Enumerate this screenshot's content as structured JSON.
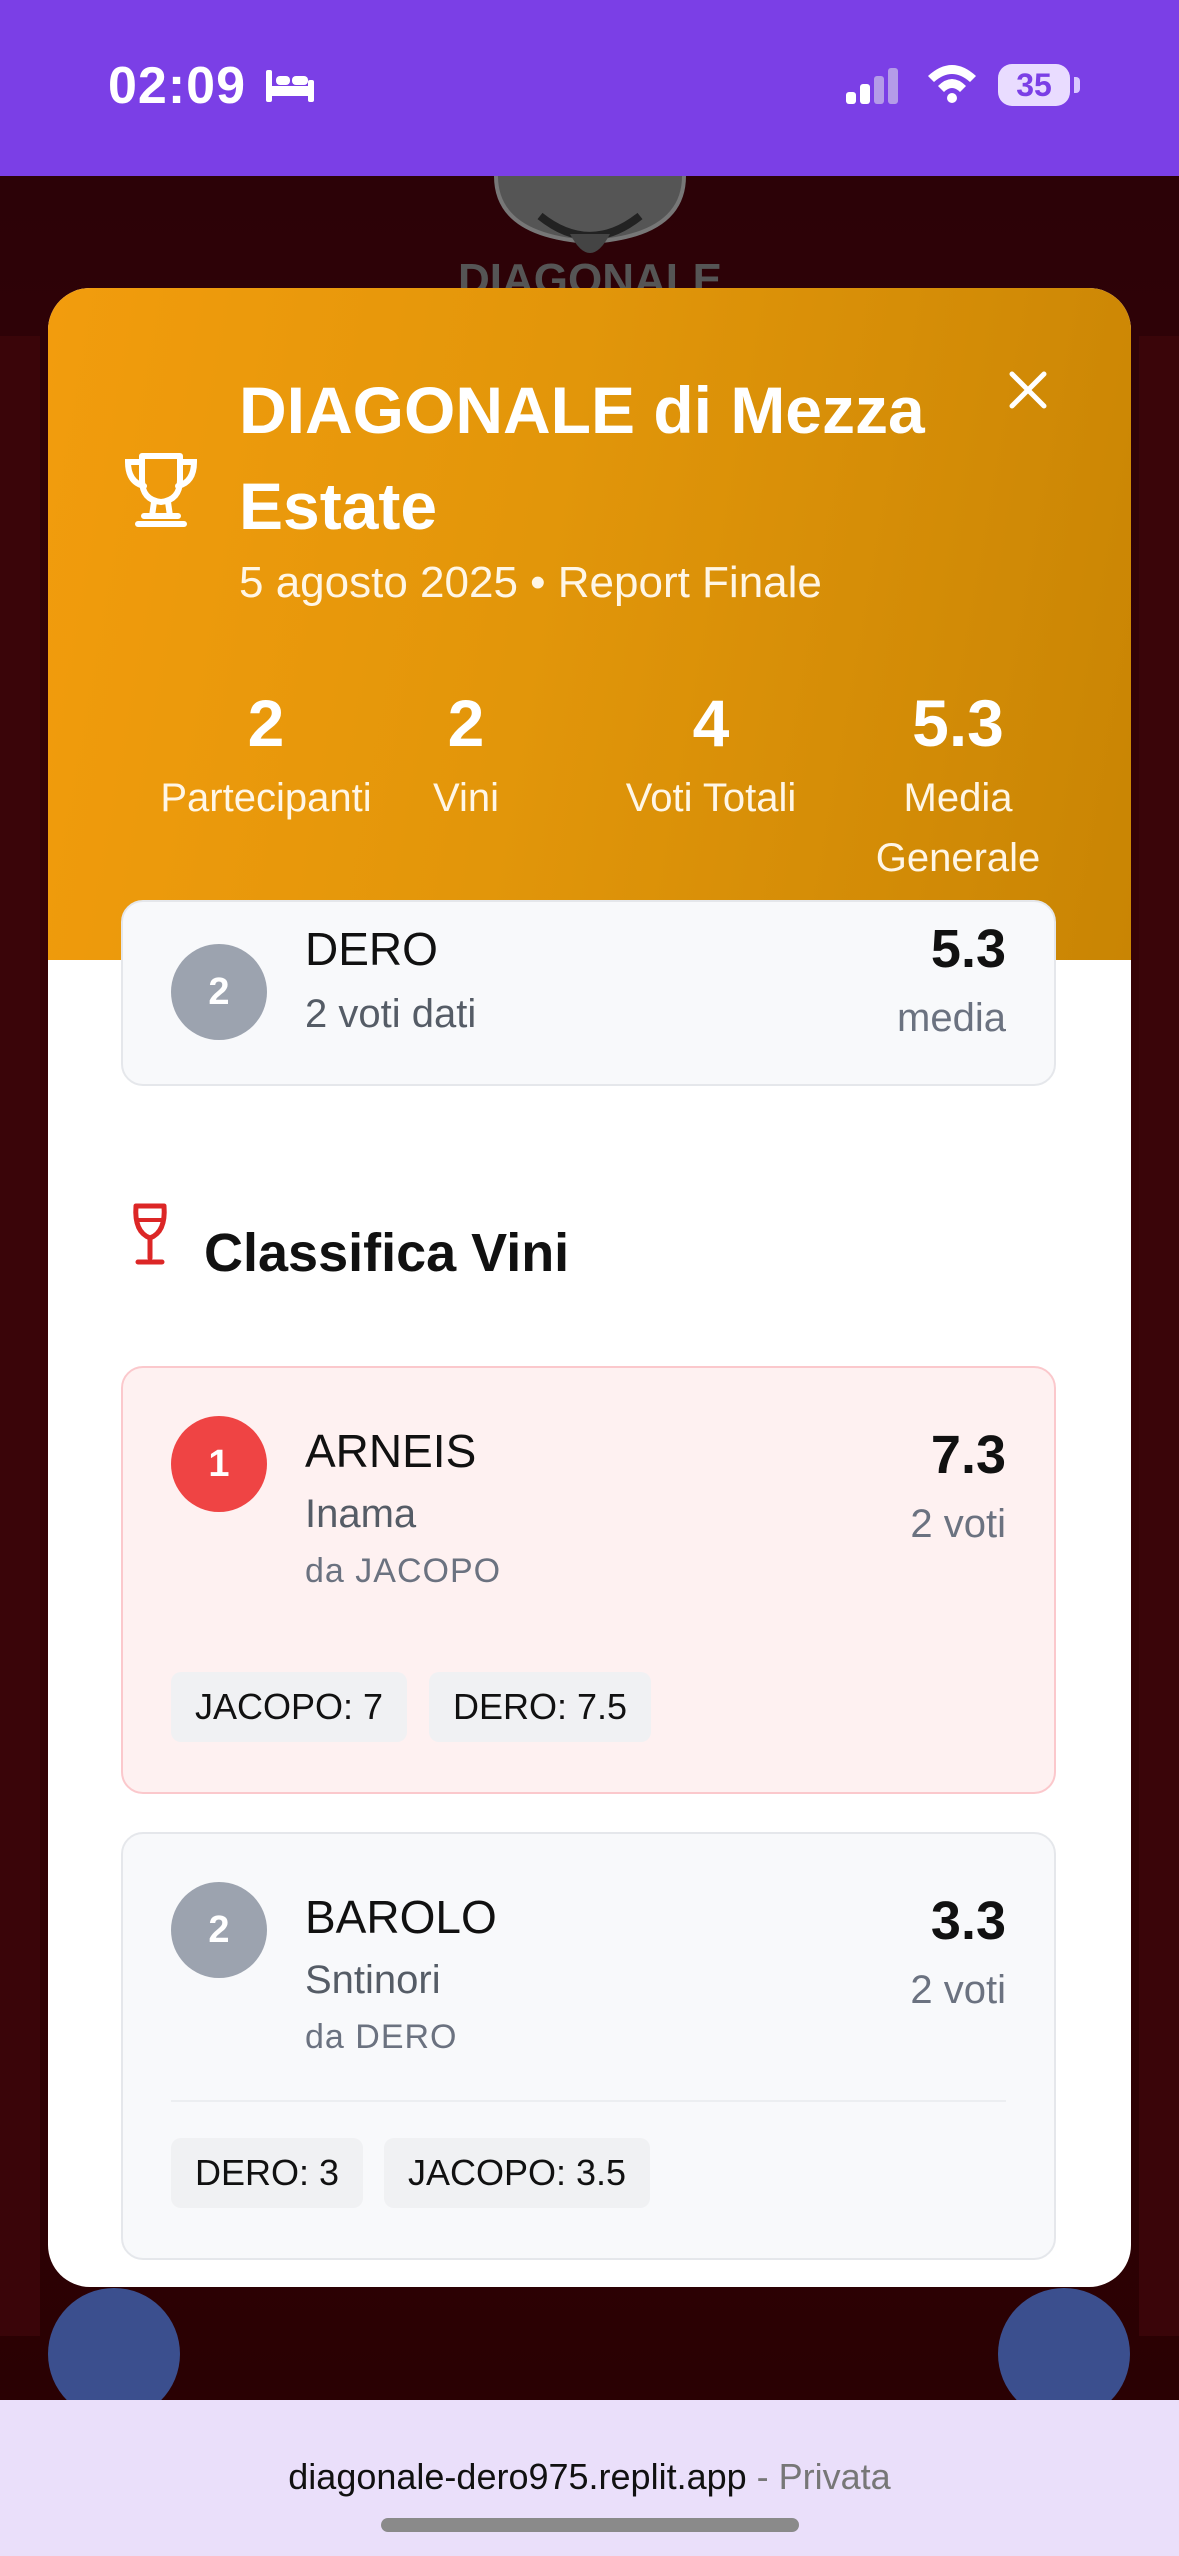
{
  "status_bar": {
    "time": "02:09",
    "battery": "35",
    "icons": [
      "bed-icon",
      "signal-icon",
      "wifi-icon",
      "battery-icon"
    ]
  },
  "background": {
    "logo_text": "DIAGONALE"
  },
  "modal": {
    "title": "DIAGONALE di Mezza Estate",
    "subtitle": "5 agosto 2025 • Report Finale",
    "accent_color": "#f29c0d",
    "stats": [
      {
        "value": "2",
        "label": "Partecipanti"
      },
      {
        "value": "2",
        "label": "Vini"
      },
      {
        "value": "4",
        "label": "Voti Totali"
      },
      {
        "value": "5.3",
        "label": "Media Generale"
      }
    ],
    "participant_partial": {
      "rank": "2",
      "name": "DERO",
      "votes": "2 voti dati",
      "score": "5.3",
      "score_label": "media"
    },
    "wine_section": {
      "title": "Classifica Vini",
      "wines": [
        {
          "rank": "1",
          "name": "ARNEIS",
          "producer": "Inama",
          "by": "da JACOPO",
          "score": "7.3",
          "votes": "2 voti",
          "chips": [
            "JACOPO: 7",
            "DERO: 7.5"
          ]
        },
        {
          "rank": "2",
          "name": "BAROLO",
          "producer": "Sntinori",
          "by": "da DERO",
          "score": "3.3",
          "votes": "2 voti",
          "chips": [
            "DERO: 3",
            "JACOPO: 3.5"
          ]
        }
      ]
    }
  },
  "browser": {
    "url": "diagonale-dero975.replit.app",
    "privacy": "- Privata"
  }
}
